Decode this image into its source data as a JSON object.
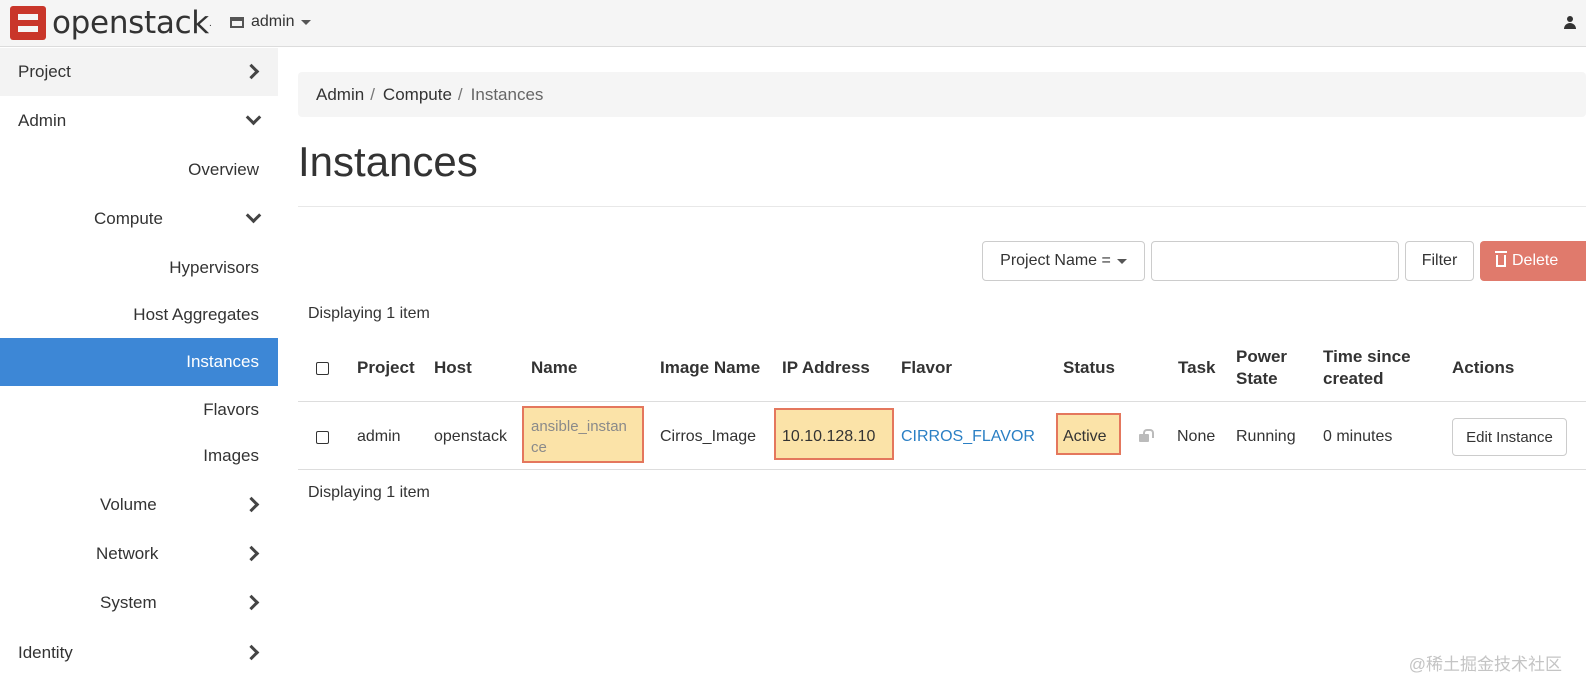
{
  "navbar": {
    "brand": "openstack",
    "brand_mark": ".",
    "project": "admin"
  },
  "sidebar": {
    "project": "Project",
    "admin": "Admin",
    "overview": "Overview",
    "compute": "Compute",
    "hypervisors": "Hypervisors",
    "host_aggregates": "Host Aggregates",
    "instances": "Instances",
    "flavors": "Flavors",
    "images": "Images",
    "volume": "Volume",
    "network": "Network",
    "system": "System",
    "identity": "Identity"
  },
  "breadcrumb": {
    "admin": "Admin",
    "compute": "Compute",
    "current": "Instances",
    "separator": "/"
  },
  "page": {
    "title": "Instances"
  },
  "filter": {
    "select_label": "Project Name =",
    "input_value": "",
    "filter_button": "Filter",
    "delete_button": "Delete"
  },
  "table": {
    "display_top": "Displaying 1 item",
    "display_bottom": "Displaying 1 item",
    "headers": {
      "project": "Project",
      "host": "Host",
      "name": "Name",
      "image_name": "Image Name",
      "ip_address": "IP Address",
      "flavor": "Flavor",
      "status": "Status",
      "task": "Task",
      "power_state_1": "Power",
      "power_state_2": "State",
      "time_since_1": "Time since",
      "time_since_2": "created",
      "actions": "Actions"
    },
    "row": {
      "project": "admin",
      "host": "openstack",
      "name_line1": "ansible_instan",
      "name_line2": "ce",
      "image_name": "Cirros_Image",
      "ip_address": "10.10.128.10",
      "flavor": "CIRROS_FLAVOR",
      "status": "Active",
      "task": "None",
      "power_state": "Running",
      "time_since": "0 minutes",
      "action": "Edit Instance"
    }
  },
  "watermark": "@稀土掘金技术社区",
  "colors": {
    "accent": "#3d87d6",
    "danger": "#e07a6c",
    "highlight_fill": "#fbe3a8",
    "highlight_border": "#e4775d",
    "link": "#2a7fc4"
  },
  "icons": {
    "brand": "openstack-logo-icon",
    "project_selector": "server-icon",
    "user": "user-icon",
    "delete": "trash-icon",
    "lock": "lock-icon"
  }
}
